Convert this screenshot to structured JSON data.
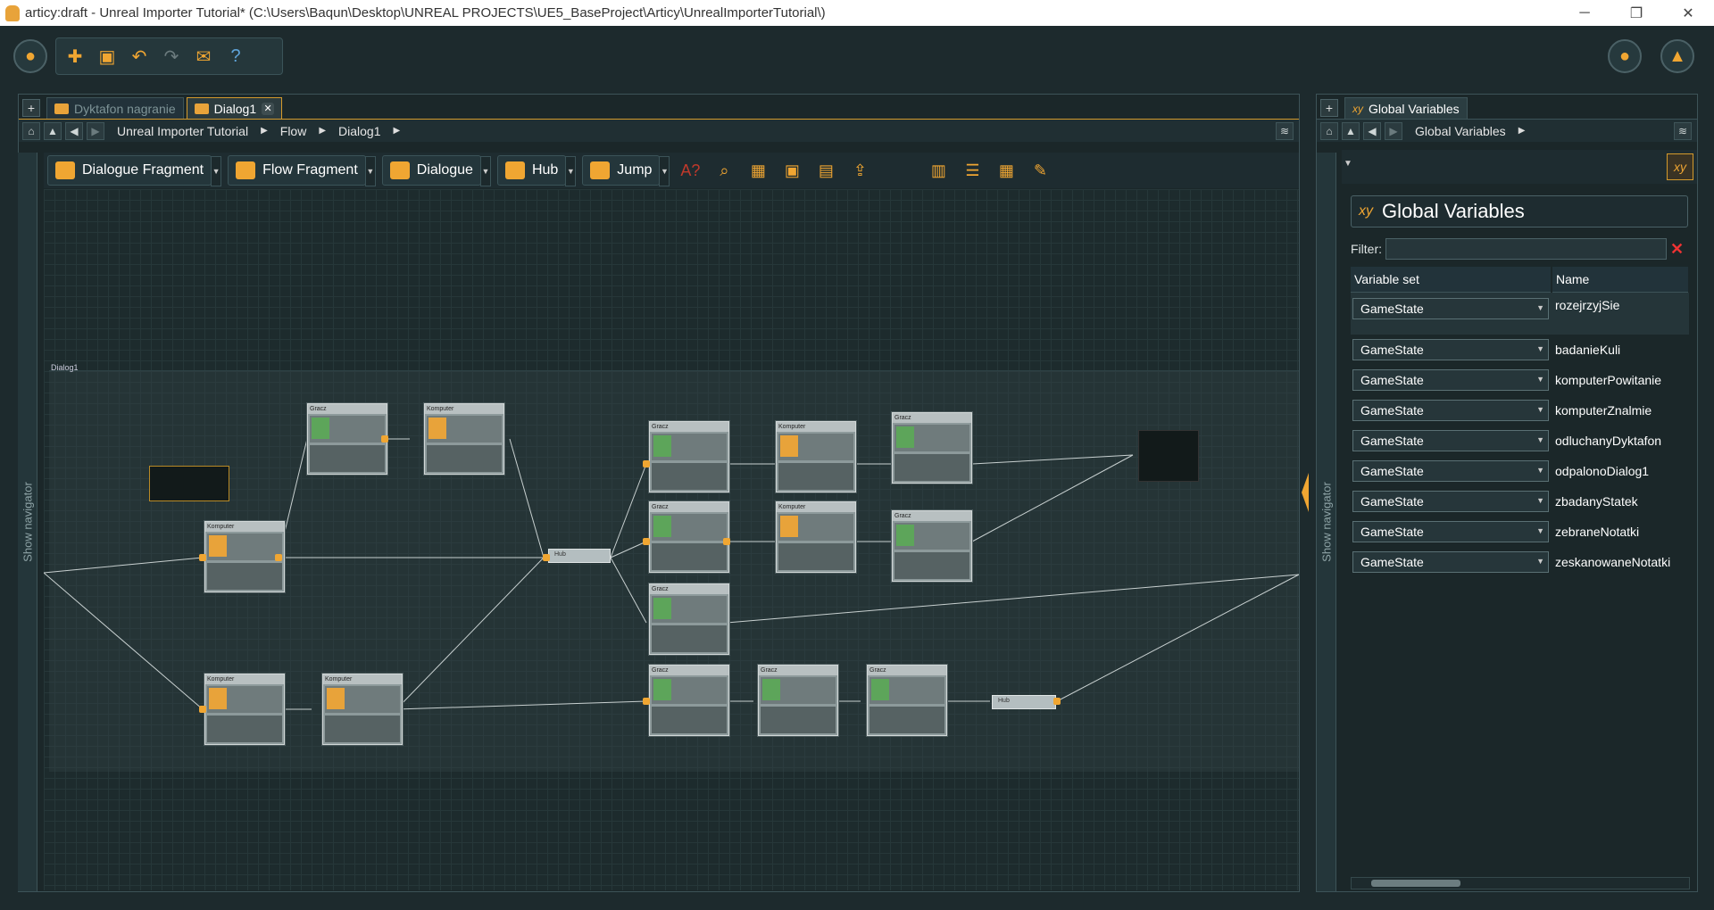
{
  "window": {
    "title": "articy:draft - Unreal Importer Tutorial* (C:\\Users\\Baqun\\Desktop\\UNREAL PROJECTS\\UE5_BaseProject\\Articy\\UnrealImporterTutorial\\)",
    "minimize": "─",
    "restore": "❐",
    "close": "✕"
  },
  "left_panel": {
    "tabs": [
      {
        "label": "Dyktafon nagranie",
        "active": false
      },
      {
        "label": "Dialog1",
        "active": true
      }
    ],
    "close_glyph": "✕",
    "breadcrumb": [
      "Unreal Importer Tutorial",
      "Flow",
      "Dialog1"
    ],
    "flow_toolbar": [
      "Dialogue Fragment",
      "Flow Fragment",
      "Dialogue",
      "Hub",
      "Jump"
    ],
    "navigator_label": "Show navigator",
    "dialog_label": "Dialog1"
  },
  "right_panel": {
    "tab": "Global Variables",
    "breadcrumb": [
      "Global Variables"
    ],
    "header": "Global Variables",
    "filter_label": "Filter:",
    "filter_value": "",
    "columns": [
      "Variable set",
      "Name"
    ],
    "rows": [
      {
        "set": "GameState",
        "name": "rozejrzyjSie"
      },
      {
        "set": "GameState",
        "name": "badanieKuli"
      },
      {
        "set": "GameState",
        "name": "komputerPowitanie"
      },
      {
        "set": "GameState",
        "name": "komputerZnalmie"
      },
      {
        "set": "GameState",
        "name": "odluchanyDyktafon"
      },
      {
        "set": "GameState",
        "name": "odpalonoDialog1"
      },
      {
        "set": "GameState",
        "name": "zbadanyStatek"
      },
      {
        "set": "GameState",
        "name": "zebraneNotatki"
      },
      {
        "set": "GameState",
        "name": "zeskanowaneNotatki"
      }
    ],
    "navigator_label": "Show navigator"
  },
  "colors": {
    "accent": "#f0a632",
    "background": "#1d2a2d",
    "active_tab_border": "#d49a2c"
  }
}
